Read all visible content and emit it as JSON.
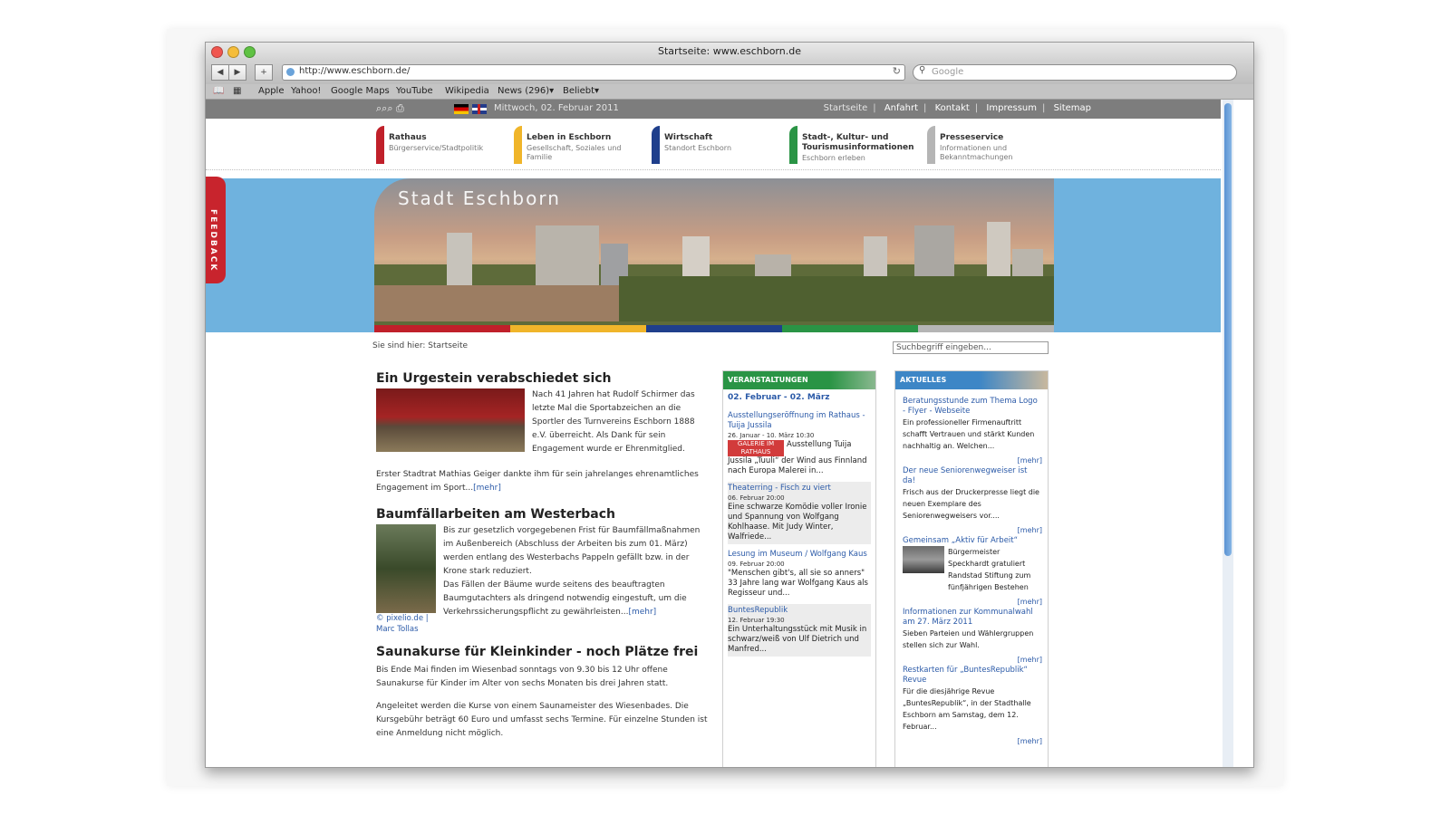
{
  "browser": {
    "window_title": "Startseite: www.eschborn.de",
    "url": "http://www.eschborn.de/",
    "search_placeholder": "Google",
    "bookmarks": [
      "Apple",
      "Yahoo!",
      "Google Maps",
      "YouTube",
      "Wikipedia",
      "News (296)▾",
      "Beliebt▾"
    ]
  },
  "topbar": {
    "tools_glyphs": "⌕⌕⌕ ⎙",
    "date": "Mittwoch, 02. Februar 2011",
    "links": [
      "Startseite",
      "Anfahrt",
      "Kontakt",
      "Impressum",
      "Sitemap"
    ],
    "separator": "|"
  },
  "nav": [
    {
      "title": "Rathaus",
      "sub": "Bürgerservice/Stadtpolitik",
      "color": "#c0202a"
    },
    {
      "title": "Leben in Eschborn",
      "sub": "Gesellschaft, Soziales und Familie",
      "color": "#f0b52a"
    },
    {
      "title": "Wirtschaft",
      "sub": "Standort Eschborn",
      "color": "#1f3f8c"
    },
    {
      "title": "Stadt-, Kultur- und Tourismusinformationen",
      "sub": "Eschborn erleben",
      "color": "#2a9445"
    },
    {
      "title": "Presseservice",
      "sub": "Informationen und Bekanntmachungen",
      "color": "#b5b5b5"
    }
  ],
  "banner": {
    "title": "Stadt Eschborn"
  },
  "feedback": "FEEDBACK",
  "breadcrumb": "Sie sind hier: Startseite",
  "site_search_placeholder": "Suchbegriff eingeben...",
  "articles": [
    {
      "title": "Ein Urgestein verabschiedet sich",
      "body1": "Nach 41 Jahren hat Rudolf Schirmer das letzte Mal die Sportabzeichen an die Sportler des Turnvereins Eschborn 1888 e.V. überreicht. Als Dank für sein Engagement wurde er Ehrenmitglied.",
      "body2": "Erster Stadtrat Mathias Geiger dankte ihm für sein jahrelanges ehrenamtliches Engagement im Sport...",
      "more": "[mehr]"
    },
    {
      "title": "Baumfällarbeiten am Westerbach",
      "body1": "Bis zur gesetzlich vorgegebenen Frist für Baumfällmaßnahmen im Außenbereich (Abschluss der Arbeiten bis zum 01. März) werden entlang des Westerbachs Pappeln gefällt bzw. in der Krone stark reduziert.",
      "body2": "Das Fällen der Bäume wurde seitens des beauftragten Baumgutachters als dringend notwendig eingestuft, um die Verkehrssicherungspflicht zu gewährleisten...",
      "more": "[mehr]",
      "credit": "© pixelio.de | Marc Tollas"
    },
    {
      "title": "Saunakurse für Kleinkinder - noch Plätze frei",
      "body1": "Bis Ende Mai finden im Wiesenbad sonntags von 9.30 bis 12 Uhr offene Saunakurse für Kinder im Alter von sechs Monaten bis drei Jahren statt.",
      "body2": "Angeleitet werden die Kurse von einem Saunameister des Wiesenbades. Die Kursgebühr beträgt 60 Euro und umfasst sechs Termine. Für einzelne Stunden ist eine Anmeldung nicht möglich."
    }
  ],
  "events": {
    "header": "VERANSTALTUNGEN",
    "date_range": "02. Februar - 02. März",
    "items": [
      {
        "title": "Ausstellungseröffnung im Rathaus -Tuija Jussila",
        "meta": "26. Januar - 10. März  10:30",
        "galerie": "GALERIE IM RATHAUS",
        "body": "Ausstellung Tuija Jussila „Tuuli“ der Wind aus Finnland nach Europa Malerei in..."
      },
      {
        "title": "Theaterring - Fisch zu viert",
        "meta": "06. Februar  20:00",
        "body": "Eine schwarze Komödie voller Ironie und Spannung von Wolfgang Kohlhaase. Mit Judy Winter, Walfriede..."
      },
      {
        "title": "Lesung im Museum / Wolfgang Kaus",
        "meta": "09. Februar  20:00",
        "body": "\"Menschen gibt's, all sie so anners\" 33 Jahre lang war Wolfgang Kaus als Regisseur und..."
      },
      {
        "title": "BuntesRepublik",
        "meta": "12. Februar  19:30",
        "body": "Ein Unterhaltungsstück mit Musik in schwarz/weiß von Ulf Dietrich und Manfred..."
      }
    ]
  },
  "news": {
    "header": "AKTUELLES",
    "more": "[mehr]",
    "items": [
      {
        "title": "Beratungsstunde zum Thema Logo - Flyer - Webseite",
        "body": "Ein professioneller Firmenauftritt schafft Vertrauen und stärkt Kunden nachhaltig an. Welchen..."
      },
      {
        "title": "Der neue Seniorenwegweiser ist da!",
        "body": "Frisch aus der Druckerpresse liegt die neuen Exemplare des Seniorenwegweisers vor...."
      },
      {
        "title": "Gemeinsam „Aktiv für Arbeit“",
        "body": "Bürgermeister Speckhardt gratuliert Randstad Stiftung zum fünfjährigen Bestehen"
      },
      {
        "title": "Informationen zur Kommunalwahl am 27. März 2011",
        "body": "Sieben Parteien und Wählergruppen stellen sich zur Wahl."
      },
      {
        "title": "Restkarten für „BuntesRepublik“ Revue",
        "body": "Für die diesjährige Revue „BuntesRepublik“, in der Stadthalle Eschborn am Samstag, dem 12. Februar..."
      }
    ]
  }
}
